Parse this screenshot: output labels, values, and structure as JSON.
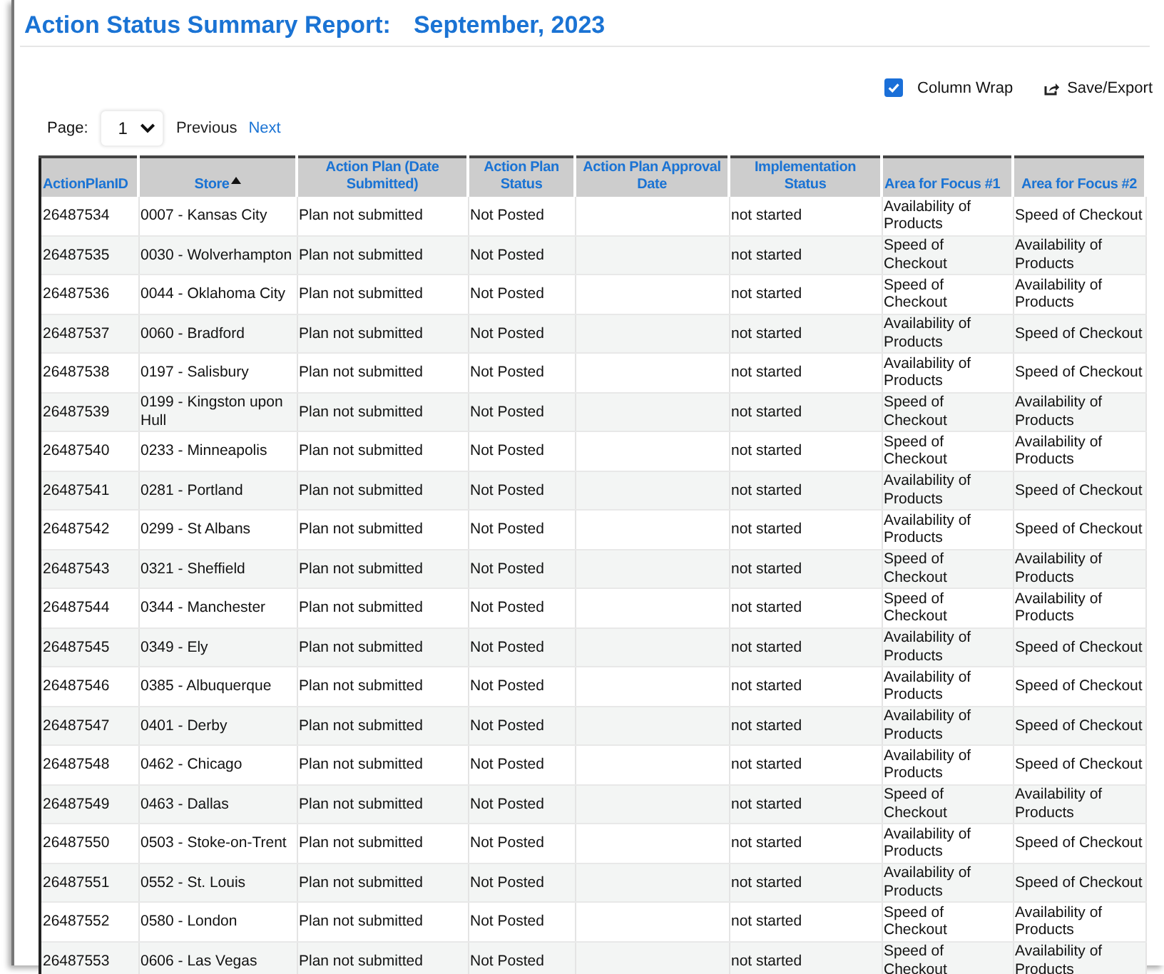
{
  "title": "Action Status Summary Report:",
  "period": "September, 2023",
  "toolbar": {
    "column_wrap": {
      "label": "Column Wrap",
      "checked": true
    },
    "export": {
      "label": "Save/Export"
    }
  },
  "pager": {
    "label": "Page:",
    "page": "1",
    "previous": {
      "label": "Previous",
      "disabled": true
    },
    "next": {
      "label": "Next",
      "disabled": false
    }
  },
  "table": {
    "columns": [
      {
        "label": "ActionPlanID",
        "sorted": false
      },
      {
        "label": "Store",
        "sorted": true
      },
      {
        "label": "Action Plan (Date Submitted)",
        "sorted": false
      },
      {
        "label": "Action Plan Status",
        "sorted": false
      },
      {
        "label": "Action Plan Approval Date",
        "sorted": false
      },
      {
        "label": "Implementation Status",
        "sorted": false
      },
      {
        "label": "Area for Focus #1",
        "sorted": false
      },
      {
        "label": "Area for Focus #2",
        "sorted": false
      }
    ],
    "rows": [
      [
        "26487534",
        "0007 - Kansas City",
        "Plan not submitted",
        "Not Posted",
        "",
        "not started",
        "Availability of Products",
        "Speed of Checkout"
      ],
      [
        "26487535",
        "0030 - Wolverhampton",
        "Plan not submitted",
        "Not Posted",
        "",
        "not started",
        "Speed of Checkout",
        "Availability of Products"
      ],
      [
        "26487536",
        "0044 - Oklahoma City",
        "Plan not submitted",
        "Not Posted",
        "",
        "not started",
        "Speed of Checkout",
        "Availability of Products"
      ],
      [
        "26487537",
        "0060 - Bradford",
        "Plan not submitted",
        "Not Posted",
        "",
        "not started",
        "Availability of Products",
        "Speed of Checkout"
      ],
      [
        "26487538",
        "0197 - Salisbury",
        "Plan not submitted",
        "Not Posted",
        "",
        "not started",
        "Availability of Products",
        "Speed of Checkout"
      ],
      [
        "26487539",
        "0199 - Kingston upon Hull",
        "Plan not submitted",
        "Not Posted",
        "",
        "not started",
        "Speed of Checkout",
        "Availability of Products"
      ],
      [
        "26487540",
        "0233 - Minneapolis",
        "Plan not submitted",
        "Not Posted",
        "",
        "not started",
        "Speed of Checkout",
        "Availability of Products"
      ],
      [
        "26487541",
        "0281 - Portland",
        "Plan not submitted",
        "Not Posted",
        "",
        "not started",
        "Availability of Products",
        "Speed of Checkout"
      ],
      [
        "26487542",
        "0299 - St Albans",
        "Plan not submitted",
        "Not Posted",
        "",
        "not started",
        "Availability of Products",
        "Speed of Checkout"
      ],
      [
        "26487543",
        "0321 - Sheffield",
        "Plan not submitted",
        "Not Posted",
        "",
        "not started",
        "Speed of Checkout",
        "Availability of Products"
      ],
      [
        "26487544",
        "0344 - Manchester",
        "Plan not submitted",
        "Not Posted",
        "",
        "not started",
        "Speed of Checkout",
        "Availability of Products"
      ],
      [
        "26487545",
        "0349 - Ely",
        "Plan not submitted",
        "Not Posted",
        "",
        "not started",
        "Availability of Products",
        "Speed of Checkout"
      ],
      [
        "26487546",
        "0385 - Albuquerque",
        "Plan not submitted",
        "Not Posted",
        "",
        "not started",
        "Availability of Products",
        "Speed of Checkout"
      ],
      [
        "26487547",
        "0401 - Derby",
        "Plan not submitted",
        "Not Posted",
        "",
        "not started",
        "Availability of Products",
        "Speed of Checkout"
      ],
      [
        "26487548",
        "0462 - Chicago",
        "Plan not submitted",
        "Not Posted",
        "",
        "not started",
        "Availability of Products",
        "Speed of Checkout"
      ],
      [
        "26487549",
        "0463 - Dallas",
        "Plan not submitted",
        "Not Posted",
        "",
        "not started",
        "Speed of Checkout",
        "Availability of Products"
      ],
      [
        "26487550",
        "0503 - Stoke-on-Trent",
        "Plan not submitted",
        "Not Posted",
        "",
        "not started",
        "Availability of Products",
        "Speed of Checkout"
      ],
      [
        "26487551",
        "0552 - St. Louis",
        "Plan not submitted",
        "Not Posted",
        "",
        "not started",
        "Availability of Products",
        "Speed of Checkout"
      ],
      [
        "26487552",
        "0580 - London",
        "Plan not submitted",
        "Not Posted",
        "",
        "not started",
        "Speed of Checkout",
        "Availability of Products"
      ],
      [
        "26487553",
        "0606 - Las Vegas",
        "Plan not submitted",
        "Not Posted",
        "",
        "not started",
        "Speed of Checkout",
        "Availability of Products"
      ]
    ]
  }
}
